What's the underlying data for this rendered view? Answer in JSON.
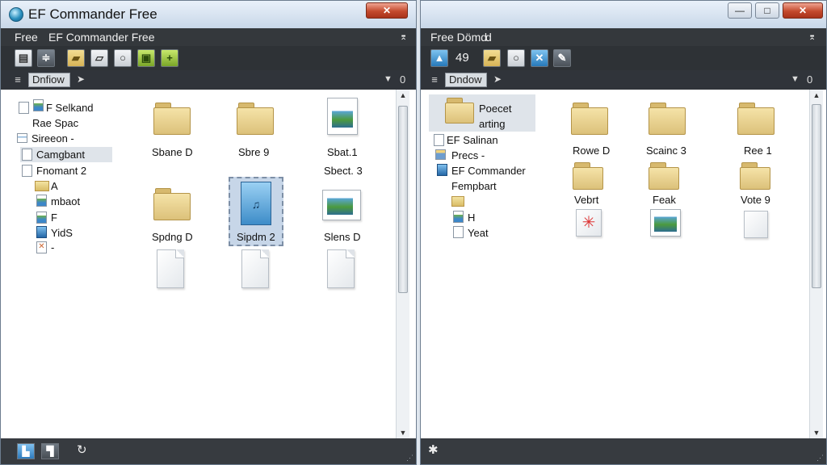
{
  "left": {
    "title": "EF Commander Free",
    "window_buttons": {
      "close": "✕"
    },
    "menu": {
      "items": [
        "Free",
        "EF Commander Free"
      ],
      "pin": "⌆"
    },
    "toolbar": {
      "icons": [
        "new-file-icon",
        "properties-icon",
        "folder-open-icon",
        "folder-icon",
        "search-icon",
        "image-icon",
        "add-icon"
      ]
    },
    "path": {
      "crumb": "Dnfiow",
      "zero": "0"
    },
    "tree": [
      {
        "label": "F Selkand",
        "icon": "image-icon"
      },
      {
        "label": "Rae Spac",
        "icon": ""
      },
      {
        "label": "Sireeon -",
        "icon": "list-icon"
      },
      {
        "label": "Camgbant",
        "icon": "document-icon",
        "selected": true
      },
      {
        "label": "Fnomant 2",
        "icon": "document-icon"
      },
      {
        "label": "A",
        "icon": "folder-icon"
      },
      {
        "label": "mbaot",
        "icon": "image-icon"
      },
      {
        "label": "F",
        "icon": "image-icon"
      },
      {
        "label": "YidS",
        "icon": "blue-document-icon"
      },
      {
        "label": "-",
        "icon": "tools-icon"
      }
    ],
    "files": [
      {
        "label": "Sbane D",
        "type": "folder"
      },
      {
        "label": "Sbre 9",
        "type": "folder"
      },
      {
        "label": "Sbat.1",
        "type": "image"
      },
      {
        "label": "Sbect. 3",
        "type": "label"
      },
      {
        "label": "Spdng D",
        "type": "folder"
      },
      {
        "label": "Sipdm 2",
        "type": "blue-document",
        "selected": true
      },
      {
        "label": "Slens D",
        "type": "image"
      },
      {
        "label": "",
        "type": "document"
      },
      {
        "label": "",
        "type": "document"
      },
      {
        "label": "",
        "type": "document"
      }
    ],
    "status": {
      "icons": [
        "panel-icon",
        "bookmark-icon",
        "refresh-icon"
      ]
    }
  },
  "right": {
    "window_buttons": {
      "minimize": "—",
      "maximize": "□",
      "close": "✕"
    },
    "menu": {
      "items": [
        "Free Dömd",
        "d"
      ],
      "pin": "⌆"
    },
    "toolbar": {
      "number": "49",
      "icons": [
        "upload-icon",
        "folder-open-icon",
        "search-icon",
        "cross-icon",
        "tools-icon"
      ]
    },
    "path": {
      "crumb": "Dndow",
      "zero": "0"
    },
    "tree": [
      {
        "label": "Poecet",
        "icon": "folder-icon"
      },
      {
        "label": "arting",
        "icon": ""
      },
      {
        "label": "EF Salinan",
        "icon": "document-icon"
      },
      {
        "label": "Precs -",
        "icon": "list-icon"
      },
      {
        "label": "EF Commander",
        "icon": "blue-document-icon"
      },
      {
        "label": "Fempbart",
        "icon": ""
      },
      {
        "label": "",
        "icon": "folder-icon"
      },
      {
        "label": "H",
        "icon": "image-icon"
      },
      {
        "label": "Yeat",
        "icon": "document-icon"
      }
    ],
    "files": [
      {
        "label": "Rowe D",
        "type": "folder"
      },
      {
        "label": "Scainc 3",
        "type": "folder"
      },
      {
        "label": "Ree 1",
        "type": "folder"
      },
      {
        "label": "Vebrt",
        "type": "folder"
      },
      {
        "label": "Feak",
        "type": "folder"
      },
      {
        "label": "Vote 9",
        "type": "folder"
      },
      {
        "label": "",
        "type": "pinned-document"
      },
      {
        "label": "",
        "type": "image"
      },
      {
        "label": "",
        "type": "document"
      }
    ],
    "status": {
      "icons": [
        "settings-icon"
      ]
    }
  }
}
